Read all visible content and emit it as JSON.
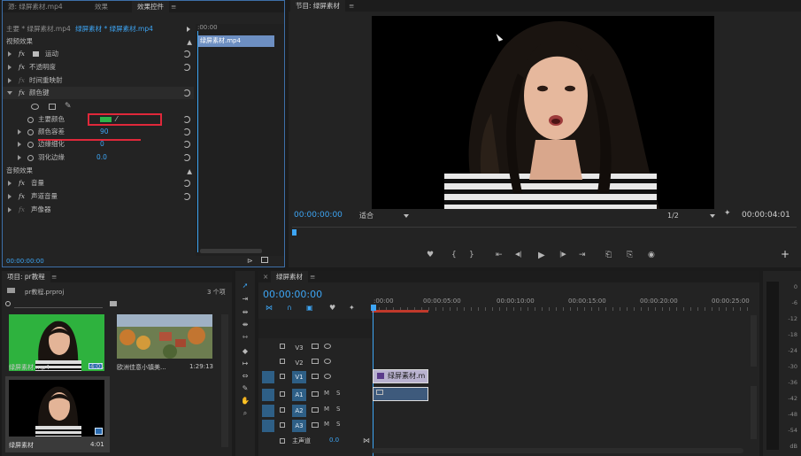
{
  "effect_controls": {
    "tabs": [
      "源: 绿屏素材.mp4",
      "效果",
      "效果控件"
    ],
    "menu_icon": "≡",
    "breadcrumb_master": "主要 * 绿屏素材.mp4",
    "breadcrumb_clip": "绿屏素材 * 绿屏素材.mp4",
    "mini_time": ":00:00",
    "mini_clip": "绿屏素材.mp4",
    "video_effects_header": "视频效果",
    "motion": "运动",
    "opacity": "不透明度",
    "time_remap": "时间重映射",
    "color_key": "颜色键",
    "key_color_label": "主要颜色",
    "key_color_value": "#2db34a",
    "tolerance_label": "颜色容差",
    "tolerance_value": "90",
    "edge_thin_label": "边缘细化",
    "edge_thin_value": "0",
    "feather_label": "羽化边缘",
    "feather_value": "0.0",
    "audio_effects_header": "音频效果",
    "volume": "音量",
    "channel_volume": "声道音量",
    "panner": "声像器",
    "timecode": "00:00:00:00",
    "fx_label": "fx"
  },
  "program_monitor": {
    "title": "节目: 绿屏素材",
    "menu_icon": "≡",
    "timecode": "00:00:00:00",
    "fit": "适合",
    "resolution": "1/2",
    "duration": "00:00:04:01",
    "controls": [
      "marker",
      "in",
      "out",
      "go-in",
      "step-back",
      "play",
      "step-forward",
      "go-out",
      "lift",
      "extract",
      "export-frame"
    ],
    "control_glyphs": [
      "♥",
      "{",
      "}",
      "⇤",
      "◀|",
      "▶",
      "|▶",
      "⇥",
      "⎗",
      "⎘",
      "◉"
    ],
    "add": "+"
  },
  "project": {
    "title": "项目: pr教程",
    "menu_icon": "≡",
    "file": "pr教程.prproj",
    "count": "3 个项",
    "items": [
      {
        "name": "绿屏素材.mp4",
        "duration": "4:01"
      },
      {
        "name": "欧洲佳意小镇美...",
        "duration": "1:29:13"
      },
      {
        "name": "绿屏素材",
        "duration": "4:01"
      }
    ]
  },
  "timeline": {
    "title": "绿屏素材",
    "menu_icon": "≡",
    "close": "×",
    "timecode": "00:00:00:00",
    "ruler": [
      ":00:00",
      "00:00:05:00",
      "00:00:10:00",
      "00:00:15:00",
      "00:00:20:00",
      "00:00:25:00"
    ],
    "video_tracks": [
      "V3",
      "V2",
      "V1"
    ],
    "audio_tracks": [
      "A1",
      "A2",
      "A3"
    ],
    "master": "主声道",
    "master_value": "0.0",
    "mute": "M",
    "solo": "S",
    "clip_v1": "绿屏素材.m",
    "clip_fx": "fx"
  },
  "meter": {
    "labels": [
      "0",
      "-6",
      "-12",
      "-18",
      "-24",
      "-30",
      "-36",
      "-42",
      "-48",
      "-54",
      "dB"
    ]
  }
}
